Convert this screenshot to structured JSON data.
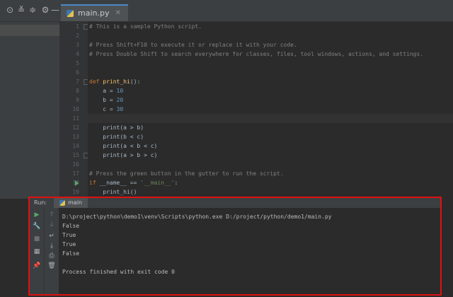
{
  "editor": {
    "tab_label": "main.py",
    "lines": [
      {
        "n": "1",
        "html": "<span class='cmt'># This is a sample Python script.</span>"
      },
      {
        "n": "2",
        "html": ""
      },
      {
        "n": "3",
        "html": "<span class='cmt'># Press Shift+F10 to execute it or replace it with your code.</span>"
      },
      {
        "n": "4",
        "html": "<span class='cmt'># Press Double Shift to search everywhere for classes, files, tool windows, actions, and settings.</span>"
      },
      {
        "n": "5",
        "html": ""
      },
      {
        "n": "6",
        "html": ""
      },
      {
        "n": "7",
        "html": "<span class='kw'>def</span> <span class='fn'>print_hi</span>():"
      },
      {
        "n": "8",
        "html": "    a = <span class='num'>10</span>"
      },
      {
        "n": "9",
        "html": "    b = <span class='num'>20</span>"
      },
      {
        "n": "10",
        "html": "    c = <span class='num'>30</span>"
      },
      {
        "n": "11",
        "html": ""
      },
      {
        "n": "12",
        "html": "    print(a &gt; b)"
      },
      {
        "n": "13",
        "html": "    print(b &lt; c)"
      },
      {
        "n": "14",
        "html": "    print(a &lt; b &lt; c)"
      },
      {
        "n": "15",
        "html": "    print(a &gt; b &gt; c)"
      },
      {
        "n": "16",
        "html": ""
      },
      {
        "n": "17",
        "html": "<span class='cmt'># Press the green button in the gutter to run the script.</span>"
      },
      {
        "n": "18",
        "html": "<span class='kw'>if</span> __name__ == <span class='str'>'__main__'</span>:"
      },
      {
        "n": "19",
        "html": "    print_hi()"
      }
    ]
  },
  "run": {
    "label": "Run:",
    "tab_label": "main",
    "output": [
      "D:\\project\\python\\demo1\\venv\\Scripts\\python.exe D:/project/python/demo1/main.py",
      "False",
      "True",
      "True",
      "False",
      "",
      "Process finished with exit code 0"
    ]
  }
}
